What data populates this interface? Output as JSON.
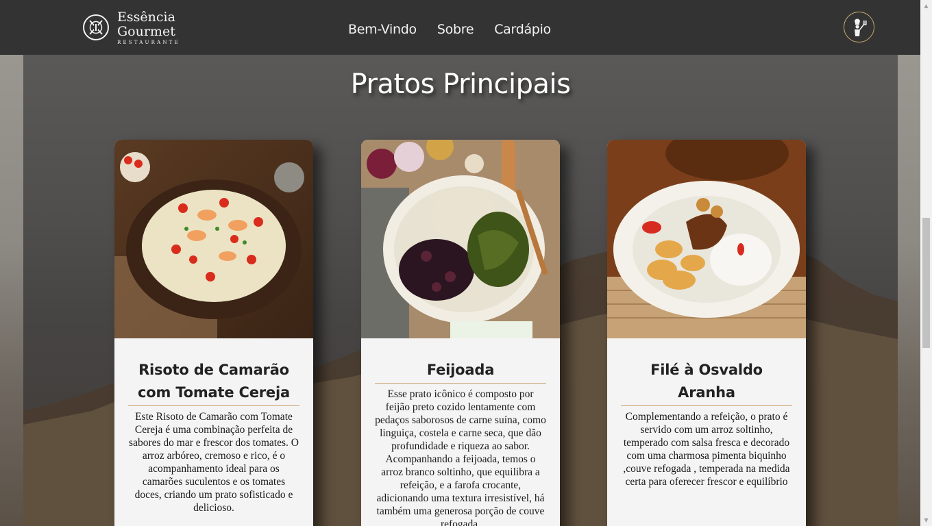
{
  "header": {
    "logo": {
      "name_line1": "Essência",
      "name_line2": "Gourmet",
      "subtitle": "RESTAURANTE"
    },
    "nav": [
      {
        "label": "Bem-Vindo"
      },
      {
        "label": "Sobre"
      },
      {
        "label": "Cardápio"
      }
    ],
    "chef_icon": "chef-icon"
  },
  "section": {
    "title": "Pratos Principais"
  },
  "cards": [
    {
      "title": "Risoto de Camarão com Tomate Cereja",
      "image": "risotto-dish-image",
      "description": "Este Risoto de Camarão com Tomate Cereja é uma combinação perfeita de sabores do mar e frescor dos tomates. O arroz arbóreo, cremoso e rico, é o acompanhamento ideal para os camarões suculentos e os tomates doces, criando um prato sofisticado e delicioso."
    },
    {
      "title": "Feijoada",
      "image": "feijoada-dish-image",
      "description": "Esse prato icônico é composto por feijão preto cozido lentamente com pedaços saborosos de carne suína, como linguiça, costela e carne seca, que dão profundidade e riqueza ao sabor. Acompanhando a feijoada, temos o arroz branco soltinho, que equilibra a refeição, e a farofa crocante, adicionando uma textura irresistível, há também uma generosa porção de couve refogada."
    },
    {
      "title": "Filé à Osvaldo Aranha",
      "image": "file-osvaldo-aranha-image",
      "description": "Complementando a refeição, o prato é servido com um arroz soltinho, temperado com salsa fresca e decorado com uma charmosa pimenta biquinho ,couve refogada , temperada na medida certa para oferecer frescor e equilíbrio"
    }
  ],
  "colors": {
    "header_bg": "#333333",
    "accent": "#c9a070",
    "card_bg": "#f4f4f4"
  }
}
